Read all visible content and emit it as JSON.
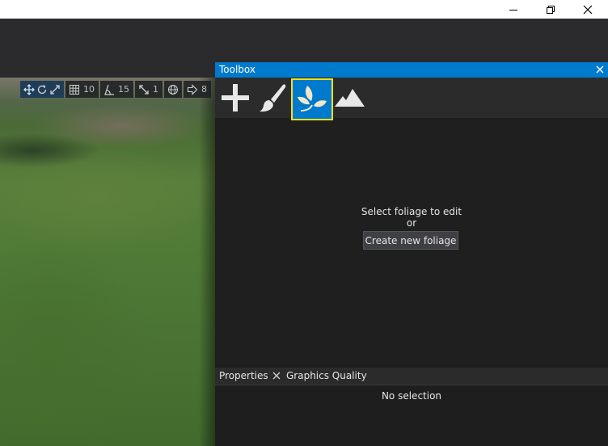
{
  "window": {
    "minimize": "minimize",
    "restore": "restore",
    "close": "close"
  },
  "viewport_toolbar": {
    "grid_value": "10",
    "angle_value": "15",
    "scale_value": "1",
    "speed_value": "8"
  },
  "toolbox": {
    "title": "Toolbox",
    "tools": [
      {
        "name": "Add",
        "icon": "plus-icon"
      },
      {
        "name": "Paint",
        "icon": "brush-icon"
      },
      {
        "name": "Foliage",
        "icon": "leaves-icon",
        "selected": true
      },
      {
        "name": "Terrain",
        "icon": "mountain-icon"
      }
    ],
    "message_line1": "Select foliage to edit",
    "message_line2": "or",
    "create_button": "Create new foliage"
  },
  "properties_panel": {
    "tab1": "Properties",
    "tab2": "Graphics Quality",
    "empty_text": "No selection"
  },
  "colors": {
    "accent": "#007acc",
    "highlight": "#f2e11e",
    "panel_bg": "#1f1f1f"
  }
}
